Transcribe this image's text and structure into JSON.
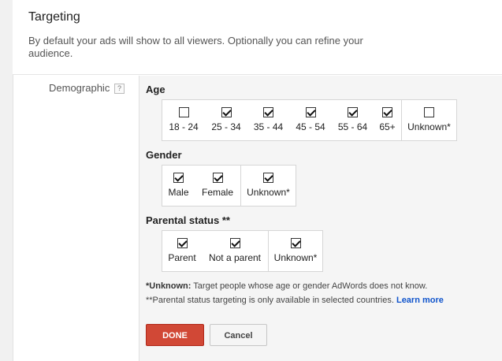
{
  "header": {
    "title": "Targeting",
    "description": "By default your ads will show to all viewers. Optionally you can refine your audience."
  },
  "demographic": {
    "label": "Demographic",
    "help_icon": "?"
  },
  "age": {
    "title": "Age",
    "options": [
      {
        "label": "18 - 24",
        "checked": false
      },
      {
        "label": "25 - 34",
        "checked": true
      },
      {
        "label": "35 - 44",
        "checked": true
      },
      {
        "label": "45 - 54",
        "checked": true
      },
      {
        "label": "55 - 64",
        "checked": true
      },
      {
        "label": "65+",
        "checked": true
      },
      {
        "label": "Unknown*",
        "checked": false
      }
    ]
  },
  "gender": {
    "title": "Gender",
    "options": [
      {
        "label": "Male",
        "checked": true
      },
      {
        "label": "Female",
        "checked": true
      },
      {
        "label": "Unknown*",
        "checked": true
      }
    ]
  },
  "parental": {
    "title": "Parental status **",
    "options": [
      {
        "label": "Parent",
        "checked": true
      },
      {
        "label": "Not a parent",
        "checked": true
      },
      {
        "label": "Unknown*",
        "checked": true
      }
    ]
  },
  "notes": {
    "unknown_bold": "*Unknown:",
    "unknown_text": " Target people whose age or gender AdWords does not know.",
    "parental_text": "**Parental status targeting is only available in selected countries. ",
    "learn_more": "Learn more"
  },
  "buttons": {
    "done": "DONE",
    "cancel": "Cancel"
  },
  "colors": {
    "done_button": "#d14836",
    "link": "#1155cc"
  }
}
